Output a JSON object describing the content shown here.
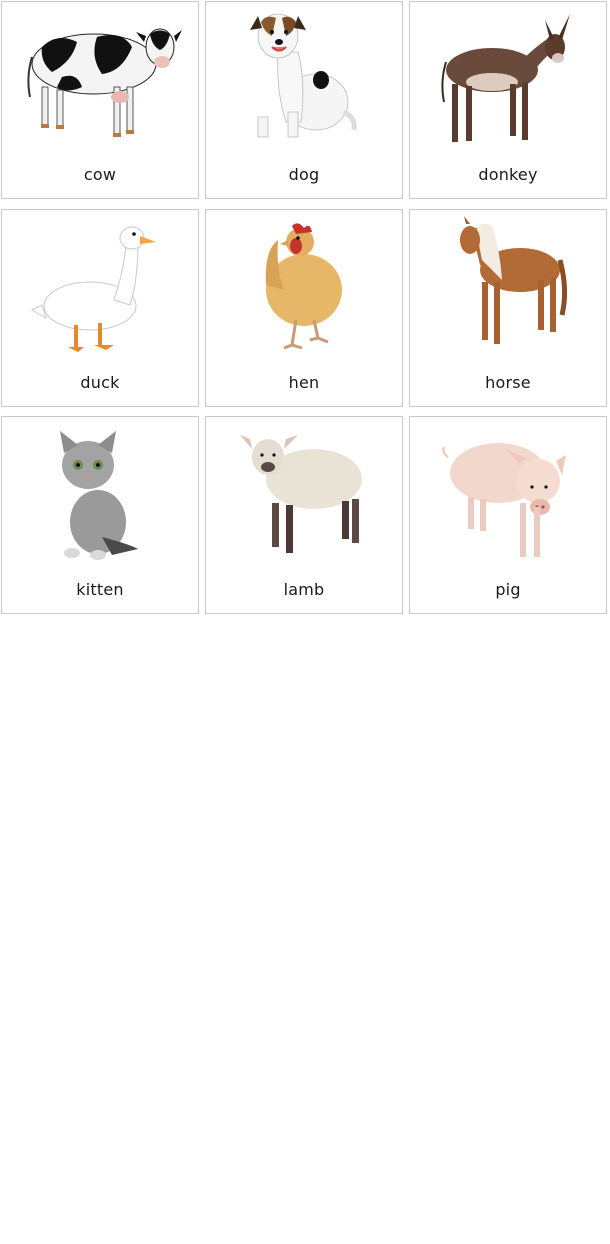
{
  "cards": [
    {
      "label": "cow",
      "icon": "cow-icon"
    },
    {
      "label": "dog",
      "icon": "dog-icon"
    },
    {
      "label": "donkey",
      "icon": "donkey-icon"
    },
    {
      "label": "duck",
      "icon": "duck-icon"
    },
    {
      "label": "hen",
      "icon": "hen-icon"
    },
    {
      "label": "horse",
      "icon": "horse-icon"
    },
    {
      "label": "kitten",
      "icon": "kitten-icon"
    },
    {
      "label": "lamb",
      "icon": "lamb-icon"
    },
    {
      "label": "pig",
      "icon": "pig-icon"
    }
  ]
}
